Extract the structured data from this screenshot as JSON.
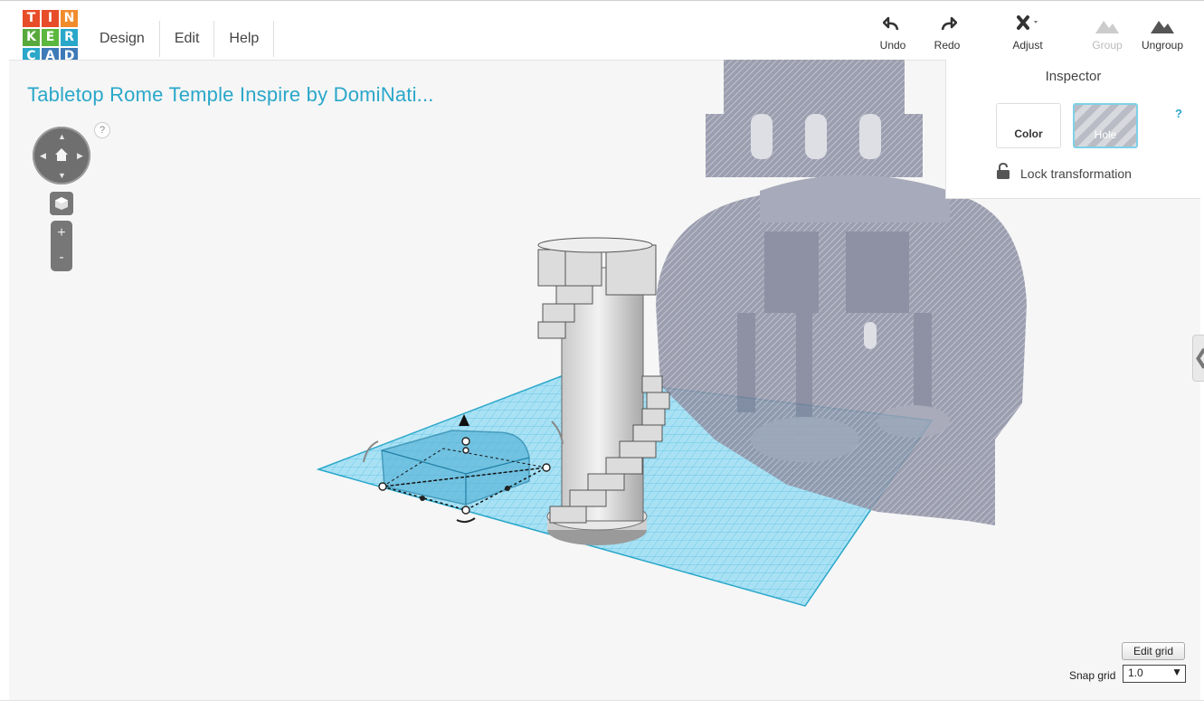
{
  "app": {
    "logo_letters": [
      "T",
      "I",
      "N",
      "K",
      "E",
      "R",
      "C",
      "A",
      "D"
    ],
    "logo_colors": [
      "#e84d2a",
      "#e84d2a",
      "#f08c2c",
      "#58a93c",
      "#5bb73e",
      "#2aa7c9",
      "#2aa7c9",
      "#3d7ab8",
      "#3d7ab8"
    ]
  },
  "menu": {
    "items": [
      {
        "label": "Design"
      },
      {
        "label": "Edit"
      },
      {
        "label": "Help"
      }
    ]
  },
  "toolbar": {
    "undo": "Undo",
    "redo": "Redo",
    "adjust": "Adjust",
    "group": "Group",
    "ungroup": "Ungroup"
  },
  "document": {
    "title": "Tabletop Rome Temple Inspire by DomiNati..."
  },
  "help": {
    "mark": "?"
  },
  "zoom": {
    "in": "+",
    "out": "-"
  },
  "inspector": {
    "title": "Inspector",
    "color_label": "Color",
    "hole_label": "Hole",
    "help": "?",
    "lock_label": "Lock transformation"
  },
  "grid": {
    "edit_label": "Edit grid",
    "snap_label": "Snap grid",
    "snap_value": "1.0"
  },
  "colors": {
    "accent": "#2aa7c9",
    "workplane": "#6fcfee",
    "hole_gray": "#8a8ea3"
  }
}
